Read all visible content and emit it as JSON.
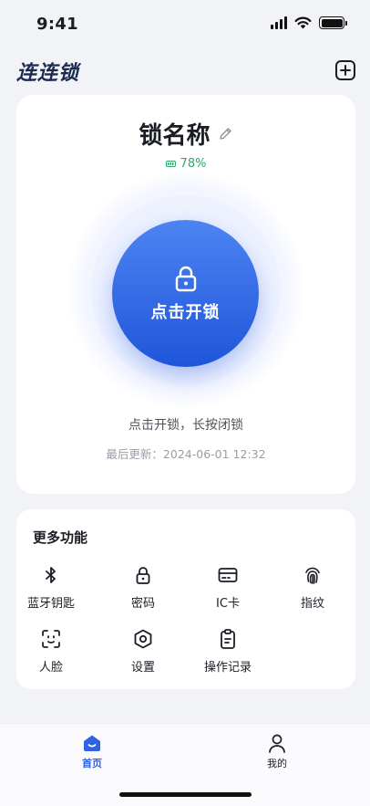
{
  "status_bar": {
    "time": "9:41"
  },
  "header": {
    "app_title": "连连锁"
  },
  "lock": {
    "name": "锁名称",
    "battery_percent": "78%",
    "unlock_label": "点击开锁",
    "hint": "点击开锁，长按闭锁",
    "last_updated": "最后更新：2024-06-01 12:32"
  },
  "features": {
    "title": "更多功能",
    "items": [
      {
        "label": "蓝牙钥匙",
        "icon": "bluetooth-icon"
      },
      {
        "label": "密码",
        "icon": "lock-icon"
      },
      {
        "label": "IC卡",
        "icon": "card-icon"
      },
      {
        "label": "指纹",
        "icon": "fingerprint-icon"
      },
      {
        "label": "人脸",
        "icon": "face-scan-icon"
      },
      {
        "label": "设置",
        "icon": "settings-hexagon-icon"
      },
      {
        "label": "操作记录",
        "icon": "clipboard-icon"
      }
    ]
  },
  "tabs": [
    {
      "label": "首页",
      "icon": "home-icon",
      "active": true
    },
    {
      "label": "我的",
      "icon": "user-icon",
      "active": false
    }
  ],
  "colors": {
    "accent": "#2f63e0",
    "battery_green": "#2fa86a",
    "background": "#f2f3f7",
    "title_navy": "#1b2a4e"
  }
}
